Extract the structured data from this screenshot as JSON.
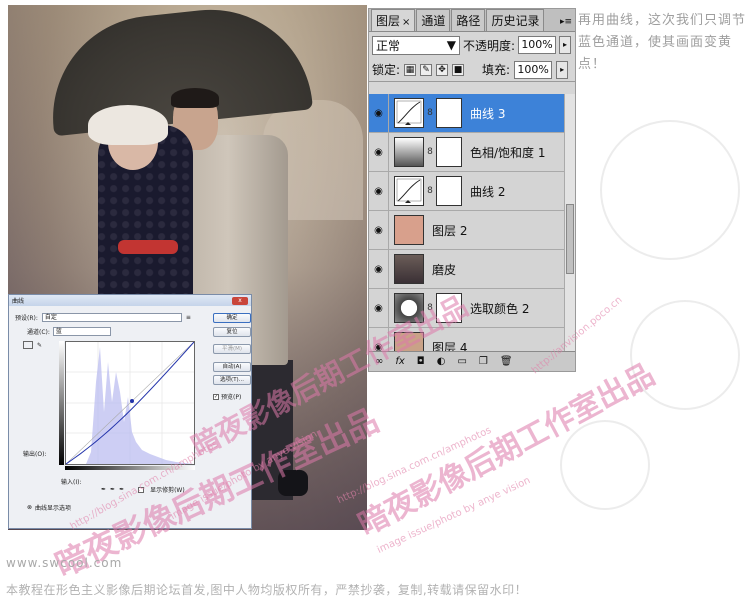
{
  "layers_panel": {
    "tabs": [
      {
        "label": "图层",
        "close": "×"
      },
      {
        "label": "通道"
      },
      {
        "label": "路径"
      },
      {
        "label": "历史记录"
      }
    ],
    "menu_arrow": "▸≡",
    "blend_mode": "正常",
    "opacity_label": "不透明度:",
    "opacity_value": "100%",
    "lock_label": "锁定:",
    "fill_label": "填充:",
    "fill_value": "100%",
    "layers": [
      {
        "name": "曲线 3",
        "kind": "curves",
        "selected": true,
        "mask": true
      },
      {
        "name": "色相/饱和度 1",
        "kind": "hue",
        "selected": false,
        "mask": true
      },
      {
        "name": "曲线 2",
        "kind": "curves",
        "selected": false,
        "mask": true
      },
      {
        "name": "图层 2",
        "kind": "pixel",
        "thumb_color": "#d8a08c",
        "selected": false,
        "mask": false
      },
      {
        "name": "磨皮",
        "kind": "photo",
        "selected": false,
        "mask": false
      },
      {
        "name": "选取颜色 2",
        "kind": "selective",
        "selected": false,
        "mask": true
      },
      {
        "name": "图层 4",
        "kind": "pixel",
        "thumb_color": "#c9a287",
        "selected": false,
        "mask": false
      }
    ],
    "bottom_icons": [
      "link-icon",
      "fx-icon",
      "mask-icon",
      "adjustment-icon",
      "group-icon",
      "new-layer-icon",
      "trash-icon"
    ]
  },
  "curves_dialog": {
    "title": "曲线",
    "close": "x",
    "preset_label": "预设(R):",
    "preset_value": "自定",
    "channel_label": "通道(C):",
    "channel_value": "蓝",
    "output_label": "输出(O):",
    "input_label": "输入(I):",
    "buttons": [
      "确定",
      "复位",
      "平滑(M)",
      "自动(A)",
      "选项(T)..."
    ],
    "preview_label": "预览(P)",
    "show_clipping_label": "显示修剪(W)",
    "curve_options_label": "曲线显示选项"
  },
  "note": "再用曲线，这次我们只调节蓝色通道，使其画面变黄点！",
  "site": "www.swcool.com",
  "copyright": "本教程在形色主义影像后期论坛首发,图中人物均版权所有，严禁抄袭，复制,转载请保留水印！",
  "watermarks": {
    "big": "暗夜影像后期工作室出品",
    "url1": "http://blog.sina.com.cn/amphotos",
    "url2": "http://anvision.poco.cn",
    "small": "image issue/photo by anye vision"
  }
}
